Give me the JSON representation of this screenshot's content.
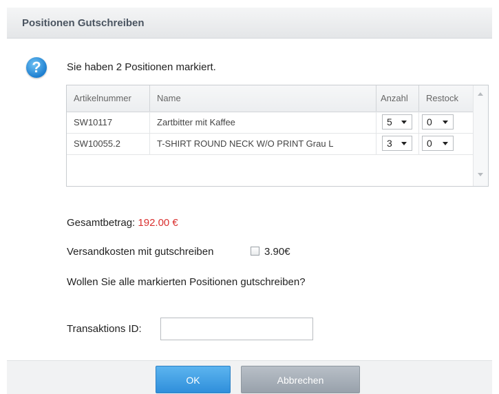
{
  "dialog": {
    "title": "Positionen Gutschreiben",
    "intro": "Sie haben 2 Positionen markiert.",
    "icon": "question-icon"
  },
  "grid": {
    "columns": [
      "Artikelnummer",
      "Name",
      "Anzahl",
      "Restock"
    ],
    "rows": [
      {
        "artikelnummer": "SW10117",
        "name": "Zartbitter mit Kaffee",
        "anzahl": "5",
        "restock": "0"
      },
      {
        "artikelnummer": "SW10055.2",
        "name": "T-SHIRT ROUND NECK W/O PRINT Grau L",
        "anzahl": "3",
        "restock": "0"
      }
    ]
  },
  "summary": {
    "total_label": "Gesamtbetrag:",
    "total_value": "192.00 €",
    "total_color": "#d9302f",
    "shipping_label": "Versandkosten mit gutschreiben",
    "shipping_amount": "3.90€",
    "shipping_checked": false,
    "question": "Wollen Sie alle markierten Positionen gutschreiben?"
  },
  "transaction": {
    "label": "Transaktions ID:",
    "value": ""
  },
  "buttons": {
    "ok": "OK",
    "cancel": "Abbrechen"
  }
}
